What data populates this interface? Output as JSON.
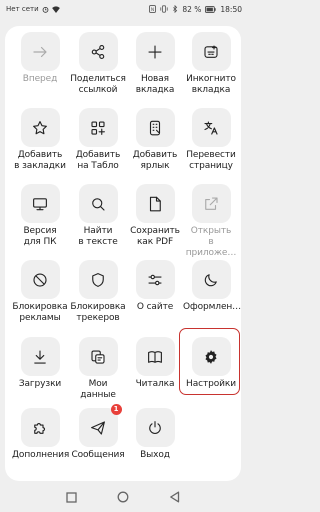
{
  "status": {
    "network": "Нет сети",
    "battery": "82 %",
    "time": "18:50"
  },
  "menu": [
    {
      "label": "Вперед",
      "icon": "arrow-right-icon",
      "disabled": true
    },
    {
      "label": "Поделиться\nссылкой",
      "icon": "share-icon"
    },
    {
      "label": "Новая\nвкладка",
      "icon": "plus-icon"
    },
    {
      "label": "Инкогнито\nвкладка",
      "icon": "incognito-tab-icon"
    },
    {
      "label": "Добавить\nв закладки",
      "icon": "star-icon"
    },
    {
      "label": "Добавить\nна Табло",
      "icon": "tableau-add-icon"
    },
    {
      "label": "Добавить\nярлык",
      "icon": "shortcut-icon"
    },
    {
      "label": "Перевести\nстраницу",
      "icon": "translate-icon"
    },
    {
      "label": "Версия\nдля ПК",
      "icon": "desktop-icon"
    },
    {
      "label": "Найти\nв тексте",
      "icon": "search-icon"
    },
    {
      "label": "Сохранить\nкак PDF",
      "icon": "pdf-icon"
    },
    {
      "label": "Открыть\nв приложе…",
      "icon": "open-external-icon",
      "disabled": true
    },
    {
      "label": "Блокировка\nрекламы",
      "icon": "block-icon"
    },
    {
      "label": "Блокировка\nтрекеров",
      "icon": "shield-icon"
    },
    {
      "label": "О сайте",
      "icon": "sliders-icon"
    },
    {
      "label": "Оформлен…",
      "icon": "moon-icon"
    },
    {
      "label": "Загрузки",
      "icon": "download-icon"
    },
    {
      "label": "Мои данные",
      "icon": "my-data-icon"
    },
    {
      "label": "Читалка",
      "icon": "book-icon"
    },
    {
      "label": "Настройки",
      "icon": "gear-icon"
    },
    {
      "label": "Дополнения",
      "icon": "puzzle-icon"
    },
    {
      "label": "Сообщения",
      "icon": "send-icon",
      "badge": "1"
    },
    {
      "label": "Выход",
      "icon": "power-icon"
    }
  ],
  "colors": {
    "highlight": "#c8332f",
    "badge": "#e8403a"
  }
}
